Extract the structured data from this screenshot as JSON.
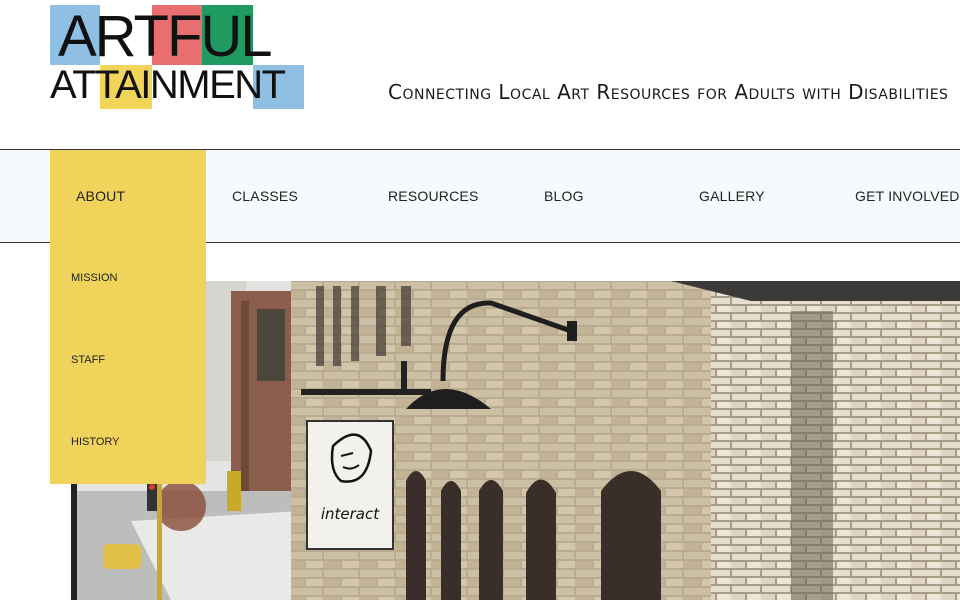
{
  "logo": {
    "line1": "ARTFUL",
    "line2": "ATTAINMENT",
    "colors": [
      "#8fc0e3",
      "#e86e6f",
      "#1f9b62",
      "#f1d45a"
    ]
  },
  "tagline": "Connecting Local Art Resources for Adults with Disabilities",
  "nav": {
    "items": [
      {
        "label": "ABOUT",
        "active": true
      },
      {
        "label": "CLASSES"
      },
      {
        "label": "RESOURCES"
      },
      {
        "label": "BLOG"
      },
      {
        "label": "GALLERY"
      },
      {
        "label": "GET INVOLVED"
      }
    ],
    "active_color": "#efd35a"
  },
  "dropdown": {
    "items": [
      {
        "label": "MISSION"
      },
      {
        "label": "STAFF"
      },
      {
        "label": "HISTORY"
      }
    ]
  },
  "hero": {
    "sign_text": "interact"
  }
}
